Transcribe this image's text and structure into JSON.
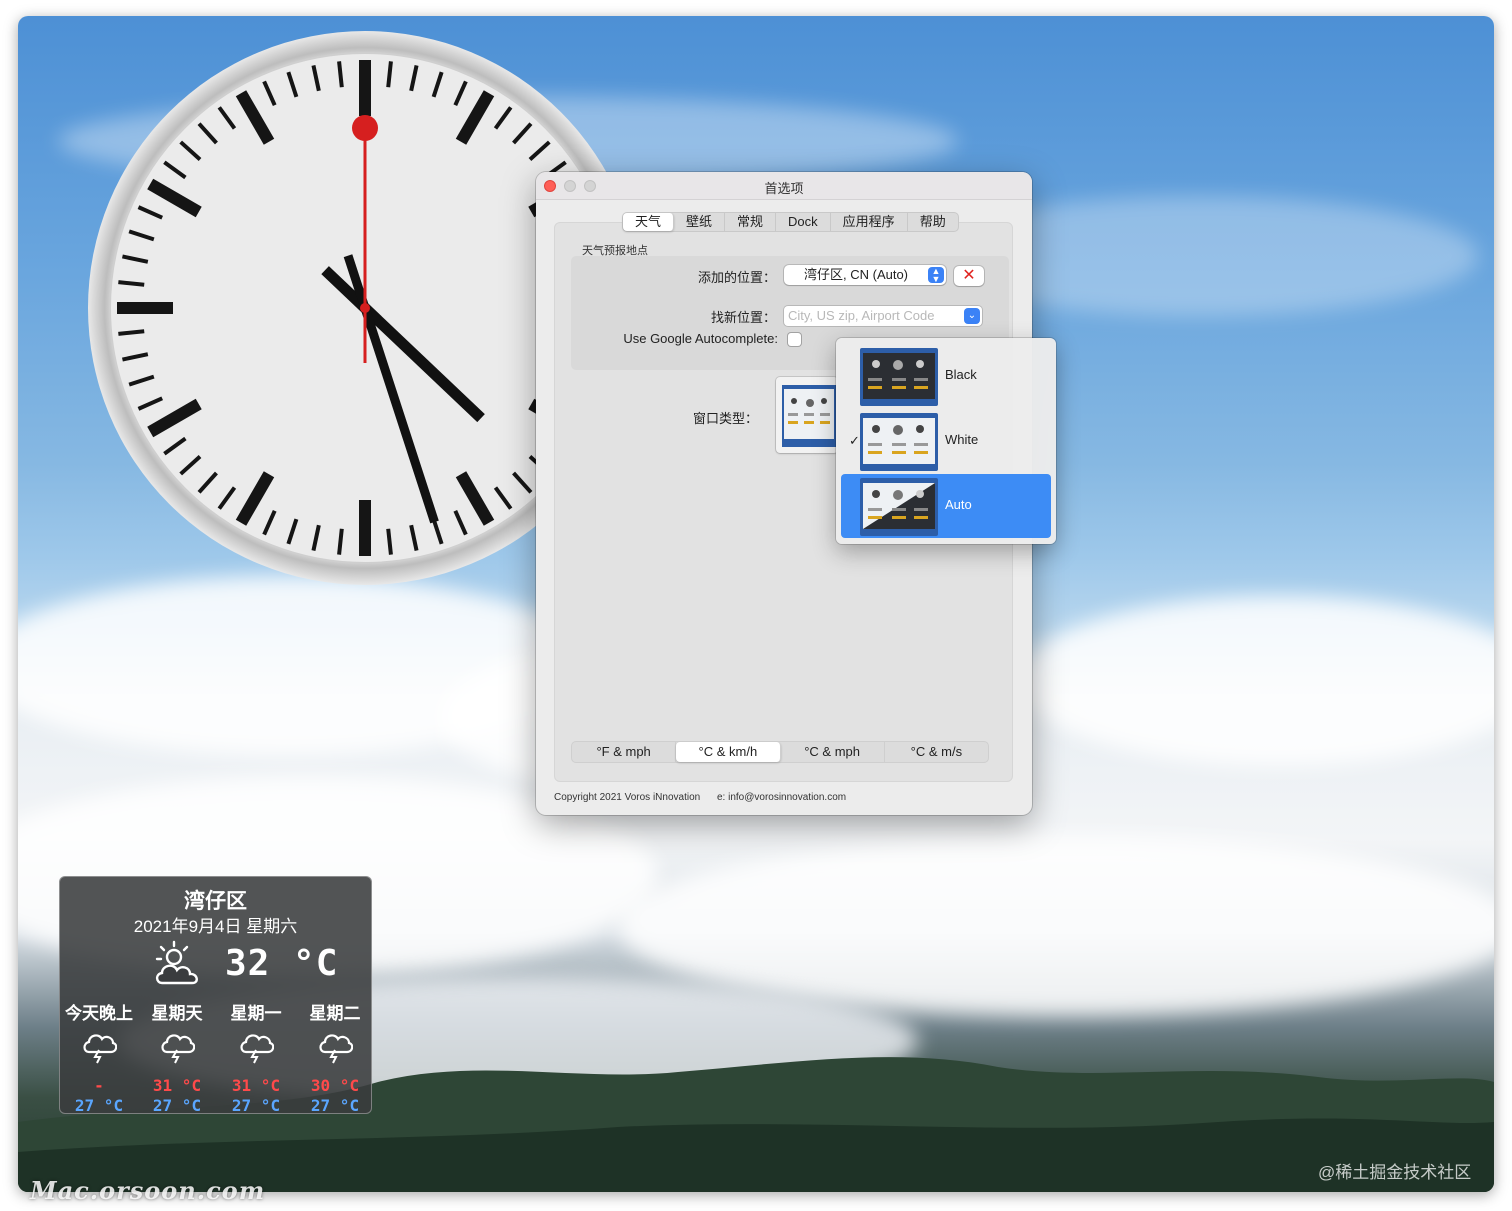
{
  "window": {
    "title": "首选项",
    "tabs": [
      {
        "label": "天气",
        "active": true
      },
      {
        "label": "壁纸",
        "active": false
      },
      {
        "label": "常规",
        "active": false
      },
      {
        "label": "Dock",
        "active": false
      },
      {
        "label": "应用程序",
        "active": false
      },
      {
        "label": "帮助",
        "active": false
      }
    ],
    "group_label": "天气预报地点",
    "added_location_label": "添加的位置：",
    "added_location_value": "湾仔区, CN (Auto)",
    "delete_symbol": "✕",
    "find_location_label": "找新位置：",
    "find_location_placeholder": "City, US zip, Airport Code",
    "autocomplete_label": "Use Google Autocomplete:",
    "window_type_label": "窗口类型：",
    "units": [
      {
        "label": "°F & mph",
        "active": false
      },
      {
        "label": "°C & km/h",
        "active": true
      },
      {
        "label": "°C & mph",
        "active": false
      },
      {
        "label": "°C & m/s",
        "active": false
      }
    ],
    "copyright": "Copyright 2021 Voros iNnovation",
    "email": "e: info@vorosinnovation.com"
  },
  "window_type_menu": {
    "items": [
      {
        "label": "Black",
        "checked": false,
        "selected": false
      },
      {
        "label": "White",
        "checked": true,
        "selected": false
      },
      {
        "label": "Auto",
        "checked": false,
        "selected": true
      }
    ],
    "check_symbol": "✓"
  },
  "weather_widget": {
    "city": "湾仔区",
    "date": "2021年9月4日 星期六",
    "current_temp": "32 °C",
    "current_icon": "partly-cloudy-icon",
    "forecast": [
      {
        "day": "今天晚上",
        "high": "-",
        "low": "27 °C",
        "icon": "thunderstorm-icon"
      },
      {
        "day": "星期天",
        "high": "31 °C",
        "low": "27 °C",
        "icon": "thunderstorm-icon"
      },
      {
        "day": "星期一",
        "high": "31 °C",
        "low": "27 °C",
        "icon": "thunderstorm-icon"
      },
      {
        "day": "星期二",
        "high": "30 °C",
        "low": "27 °C",
        "icon": "thunderstorm-icon"
      }
    ]
  },
  "clock": {
    "hour": 4,
    "minute": 27,
    "second": 0
  },
  "watermarks": {
    "left": "Mac.orsoon.com",
    "right": "@稀土掘金技术社区"
  },
  "colors": {
    "accent_blue": "#3d8cf5",
    "close_red": "#ff5f57",
    "second_hand": "#d61f1f",
    "temp_high": "#ff4a4a",
    "temp_low": "#5aa6ff"
  }
}
